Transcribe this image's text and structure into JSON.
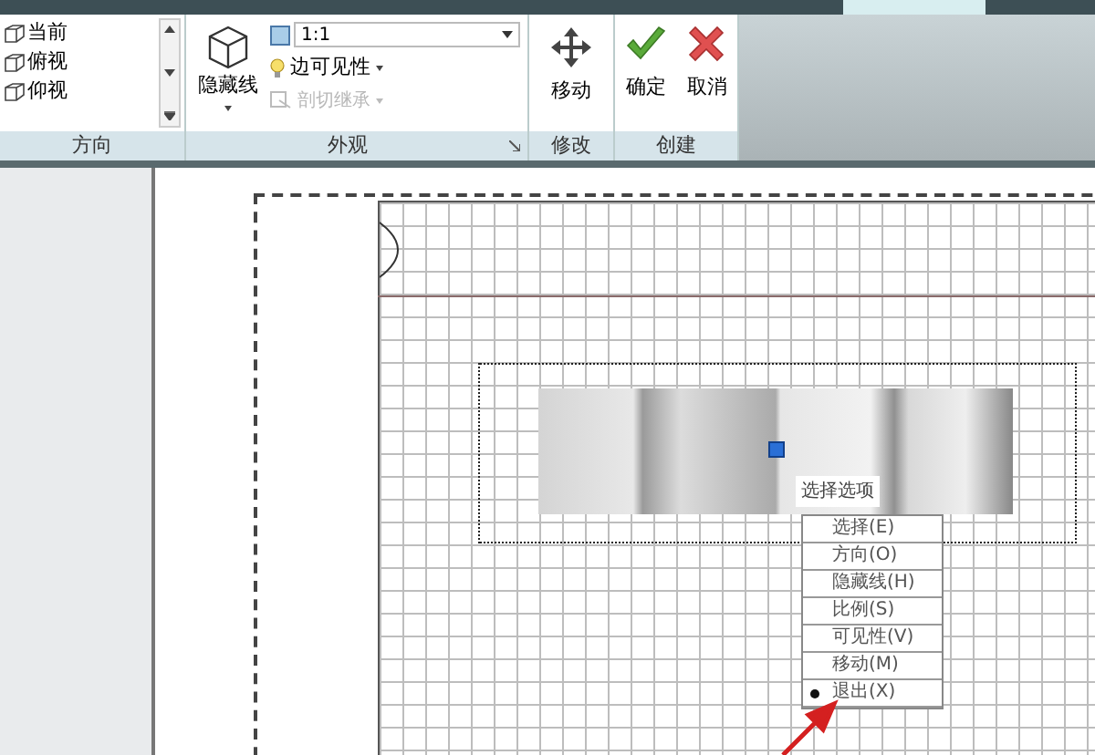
{
  "orientation": {
    "title": "方向",
    "views": [
      "当前",
      "俯视",
      "仰视"
    ]
  },
  "appearance": {
    "title": "外观",
    "hidden_lines": "隐藏线",
    "scale": "1:1",
    "edge_visibility": "边可见性",
    "cut_inherit": {
      "label": "剖切继承",
      "disabled": true
    }
  },
  "modify": {
    "title": "修改",
    "move": "移动"
  },
  "create": {
    "title": "创建",
    "ok": "确定",
    "cancel": "取消"
  },
  "canvas": {
    "tooltip": "选择选项",
    "context_menu": [
      {
        "label": "选择(E)",
        "checked": false
      },
      {
        "label": "方向(O)",
        "checked": false
      },
      {
        "label": "隐藏线(H)",
        "checked": false
      },
      {
        "label": "比例(S)",
        "checked": false
      },
      {
        "label": "可见性(V)",
        "checked": false
      },
      {
        "label": "移动(M)",
        "checked": false
      },
      {
        "label": "退出(X)",
        "checked": true
      }
    ]
  }
}
